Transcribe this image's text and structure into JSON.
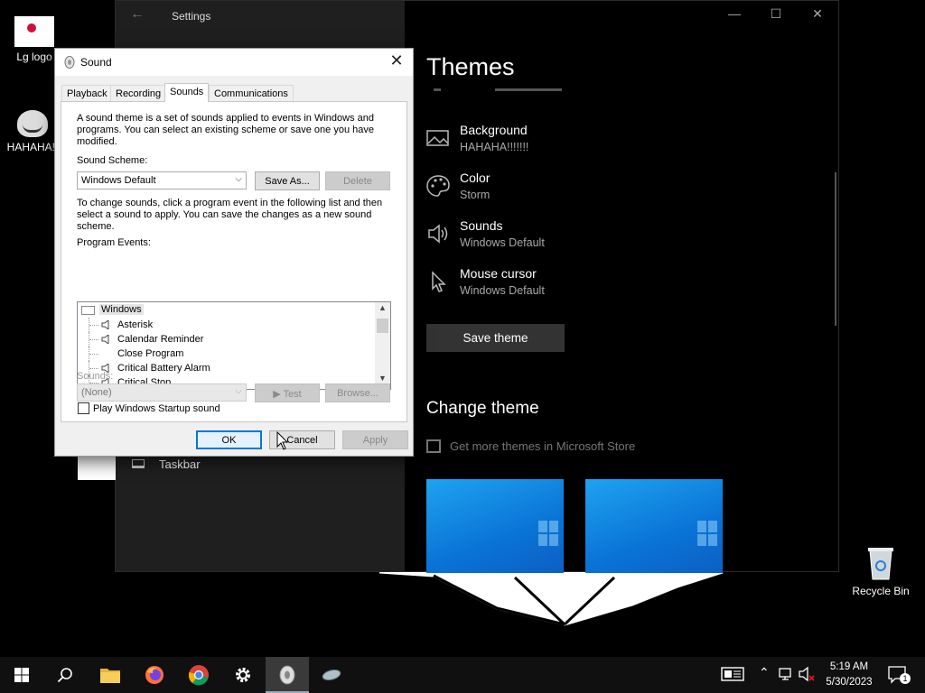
{
  "desktop": {
    "icons": [
      {
        "label": "Lg logo"
      },
      {
        "label": "HAHAHA!!"
      },
      {
        "label": "Recycle Bin"
      }
    ]
  },
  "settings": {
    "title": "Settings",
    "heading": "Themes",
    "items": [
      {
        "title": "Background",
        "value": "HAHAHA!!!!!!!",
        "icon": "picture-icon"
      },
      {
        "title": "Color",
        "value": "Storm",
        "icon": "palette-icon"
      },
      {
        "title": "Sounds",
        "value": "Windows Default",
        "icon": "speaker-icon"
      },
      {
        "title": "Mouse cursor",
        "value": "Windows Default",
        "icon": "cursor-icon"
      }
    ],
    "save_theme": "Save theme",
    "change_theme": "Change theme",
    "store_link": "Get more themes in Microsoft Store",
    "nav_taskbar": "Taskbar"
  },
  "sound_dialog": {
    "title": "Sound",
    "tabs": [
      "Playback",
      "Recording",
      "Sounds",
      "Communications"
    ],
    "active_tab": "Sounds",
    "intro": "A sound theme is a set of sounds applied to events in Windows and programs.  You can select an existing scheme or save one you have modified.",
    "scheme_label": "Sound Scheme:",
    "scheme_value": "Windows Default",
    "save_as": "Save As...",
    "delete": "Delete",
    "change_text": "To change sounds, click a program event in the following list and then select a sound to apply.  You can save the changes as a new sound scheme.",
    "events_label": "Program Events:",
    "events_root": "Windows",
    "events": [
      {
        "label": "Asterisk",
        "has_sound": true
      },
      {
        "label": "Calendar Reminder",
        "has_sound": true
      },
      {
        "label": "Close Program",
        "has_sound": false
      },
      {
        "label": "Critical Battery Alarm",
        "has_sound": true
      },
      {
        "label": "Critical Stop",
        "has_sound": true
      }
    ],
    "startup_label": "Play Windows Startup sound",
    "startup_checked": false,
    "sounds_label": "Sounds:",
    "sounds_value": "(None)",
    "test": "Test",
    "browse": "Browse...",
    "ok": "OK",
    "cancel": "Cancel",
    "apply": "Apply"
  },
  "taskbar": {
    "time": "5:19 AM",
    "date": "5/30/2023",
    "notification_count": "1",
    "apps": [
      "windows-start-icon",
      "search-icon",
      "file-explorer-icon",
      "firefox-icon",
      "chrome-icon",
      "settings-gear-icon",
      "sound-speaker-icon",
      "mouse-icon"
    ]
  },
  "colors": {
    "accent": "#0078d7",
    "settings_bg": "#000000",
    "dialog_bg": "#f0f0f0"
  }
}
